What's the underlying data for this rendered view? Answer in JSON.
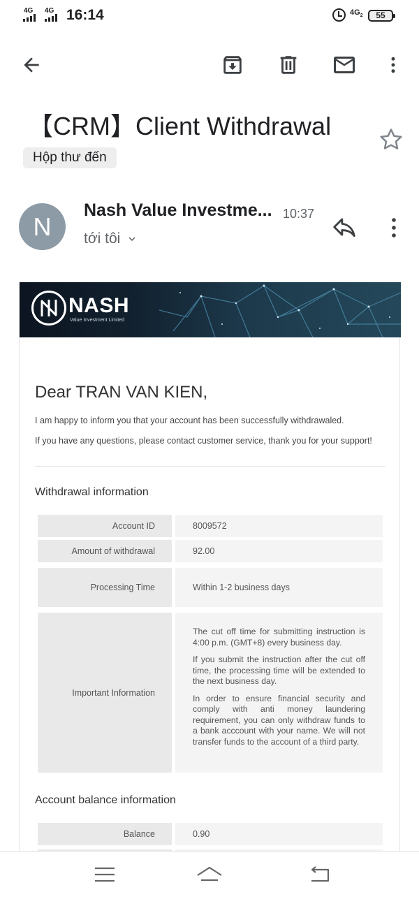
{
  "status_bar": {
    "network1": "4G",
    "network2": "4G",
    "time": "16:14",
    "network3": "4G",
    "network3_sub": "2",
    "battery": "55"
  },
  "toolbar": {
    "back_icon": "arrow-left-icon",
    "archive_icon": "archive-icon",
    "delete_icon": "trash-icon",
    "mark_unread_icon": "mail-icon",
    "more_icon": "more-vert-icon"
  },
  "email": {
    "subject": "【CRM】Client Withdrawal",
    "label": "Hộp thư đến",
    "sender_initial": "N",
    "sender_name": "Nash Value Investme...",
    "time": "10:37",
    "recipient": "tới tôi"
  },
  "body": {
    "logo_word": "NASH",
    "logo_sub": "Value Investment Limited",
    "greeting": "Dear TRAN VAN KIEN,",
    "paragraph1": "I am happy to inform you that your account has been successfully withdrawaled.",
    "paragraph2": "If you have any questions, please contact customer service, thank you for your support!",
    "withdrawal_title": "Withdrawal information",
    "rows": [
      {
        "label": "Account ID",
        "value": "8009572"
      },
      {
        "label": "Amount of withdrawal",
        "value": "92.00"
      },
      {
        "label": "Processing Time",
        "value": "Within 1-2 business days"
      },
      {
        "label": "Important Information",
        "value1": "The cut off time for submitting instruction is 4:00 p.m. (GMT+8) every business day.",
        "value2": "If you submit the instruction after the cut off time, the processing time will be extended to the next business day.",
        "value3": "In order to ensure financial security and comply with anti money laundering requirement, you can only withdraw funds to a bank acccount with your name. We will not transfer funds to the account of a third party."
      }
    ],
    "balance_title": "Account balance information",
    "balance_rows": [
      {
        "label": "Balance",
        "value": "0.90"
      }
    ]
  },
  "nav": {
    "menu_icon": "menu-icon",
    "home_icon": "home-icon",
    "back_icon": "back-icon"
  }
}
